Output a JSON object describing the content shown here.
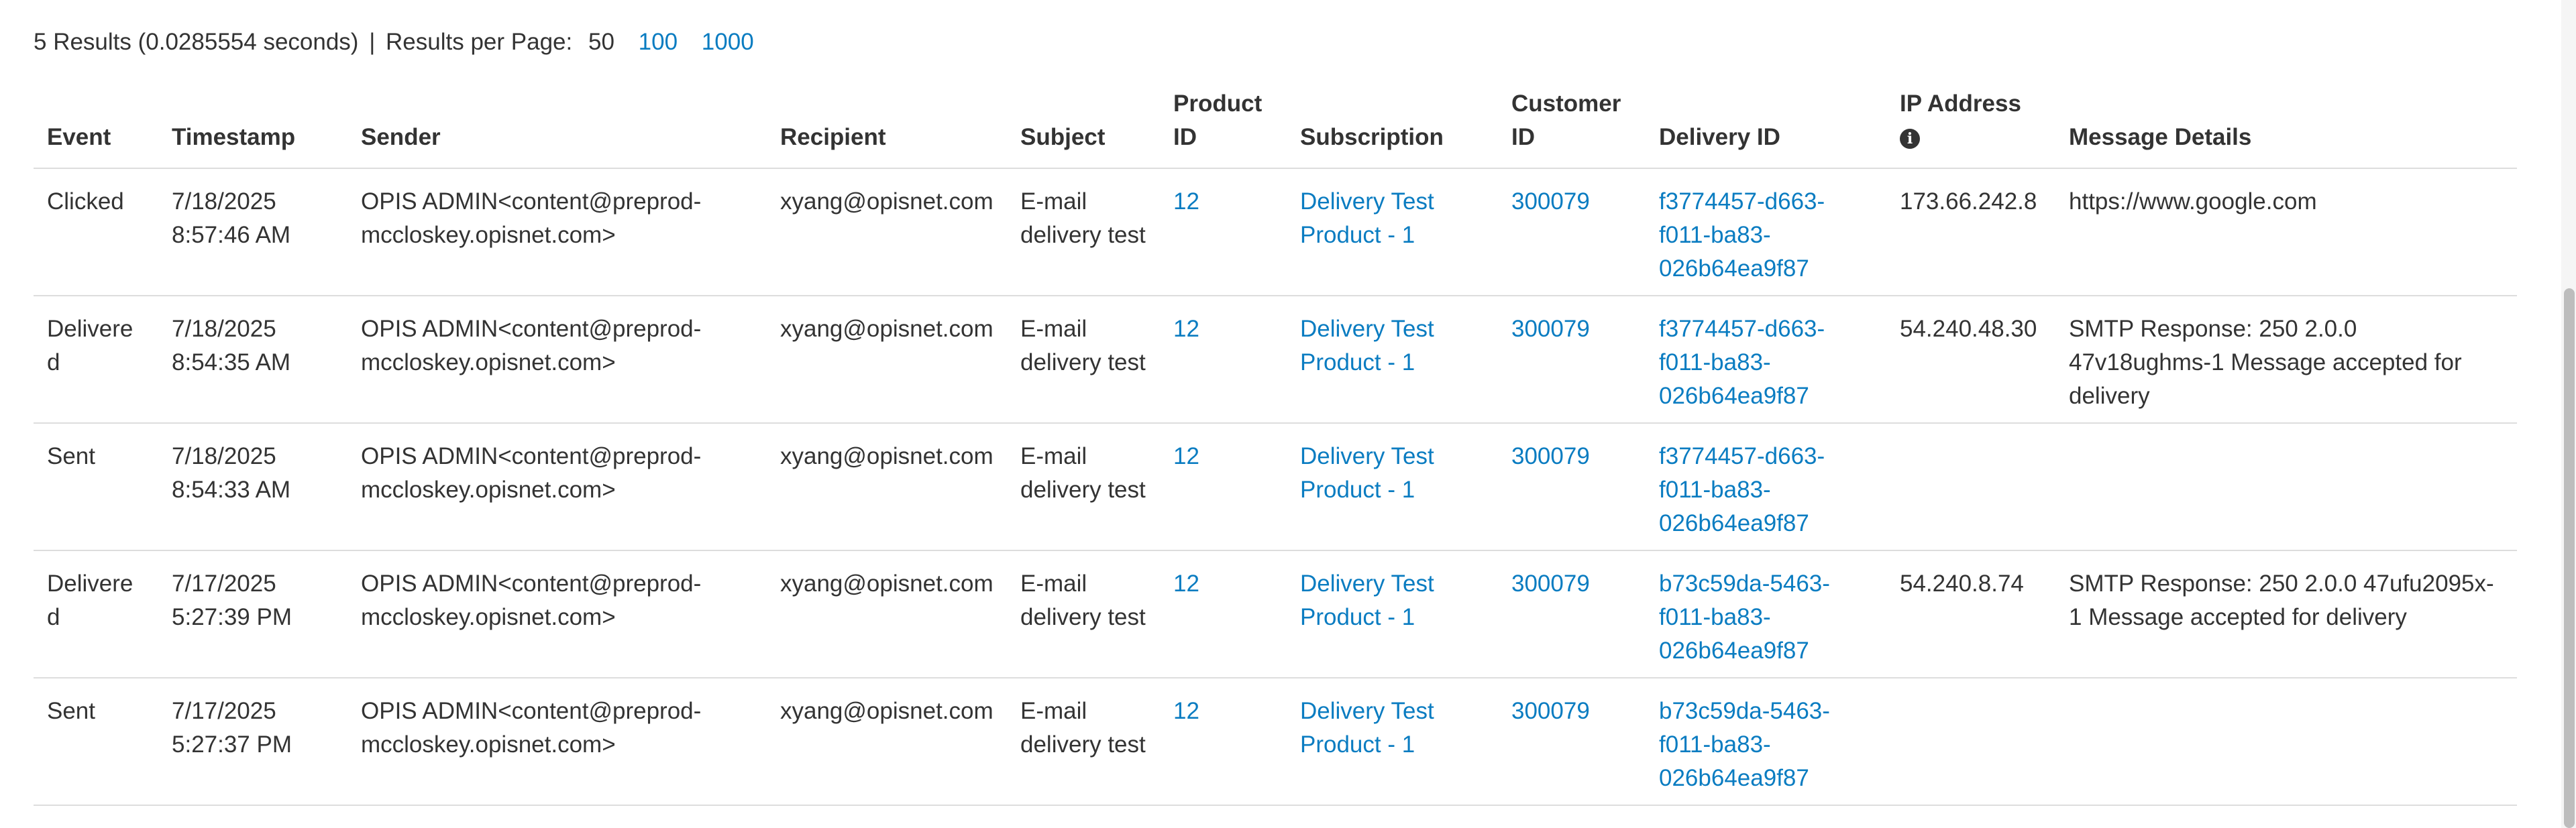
{
  "summary": {
    "results_text": "5 Results (0.0285554 seconds)",
    "separator": "|",
    "per_page_label": "Results per Page:",
    "per_page_current": "50",
    "per_page_options": [
      "100",
      "1000"
    ]
  },
  "table": {
    "headers": {
      "event": "Event",
      "timestamp": "Timestamp",
      "sender": "Sender",
      "recipient": "Recipient",
      "subject": "Subject",
      "product_id": "Product ID",
      "subscription": "Subscription",
      "customer_id": "Customer ID",
      "delivery_id": "Delivery ID",
      "ip_address": "IP Address",
      "message_details": "Message Details"
    },
    "ip_info_icon": "info-icon",
    "rows": [
      {
        "event": "Clicked",
        "timestamp": "7/18/2025 8:57:46 AM",
        "sender": "OPIS ADMIN<content@preprod-mccloskey.opisnet.com>",
        "recipient": "xyang@opisnet.com",
        "subject": "E-mail delivery test",
        "product_id": "12",
        "subscription": "Delivery Test Product - 1",
        "customer_id": "300079",
        "delivery_id": "f3774457-d663-f011-ba83-026b64ea9f87",
        "ip_address": "173.66.242.8",
        "message_details": "https://www.google.com"
      },
      {
        "event": "Delivered",
        "timestamp": "7/18/2025 8:54:35 AM",
        "sender": "OPIS ADMIN<content@preprod-mccloskey.opisnet.com>",
        "recipient": "xyang@opisnet.com",
        "subject": "E-mail delivery test",
        "product_id": "12",
        "subscription": "Delivery Test Product - 1",
        "customer_id": "300079",
        "delivery_id": "f3774457-d663-f011-ba83-026b64ea9f87",
        "ip_address": "54.240.48.30",
        "message_details": "SMTP Response: 250 2.0.0 47v18ughms-1 Message accepted for delivery"
      },
      {
        "event": "Sent",
        "timestamp": "7/18/2025 8:54:33 AM",
        "sender": "OPIS ADMIN<content@preprod-mccloskey.opisnet.com>",
        "recipient": "xyang@opisnet.com",
        "subject": "E-mail delivery test",
        "product_id": "12",
        "subscription": "Delivery Test Product - 1",
        "customer_id": "300079",
        "delivery_id": "f3774457-d663-f011-ba83-026b64ea9f87",
        "ip_address": "",
        "message_details": ""
      },
      {
        "event": "Delivered",
        "timestamp": "7/17/2025 5:27:39 PM",
        "sender": "OPIS ADMIN<content@preprod-mccloskey.opisnet.com>",
        "recipient": "xyang@opisnet.com",
        "subject": "E-mail delivery test",
        "product_id": "12",
        "subscription": "Delivery Test Product - 1",
        "customer_id": "300079",
        "delivery_id": "b73c59da-5463-f011-ba83-026b64ea9f87",
        "ip_address": "54.240.8.74",
        "message_details": "SMTP Response: 250 2.0.0 47ufu2095x-1 Message accepted for delivery"
      },
      {
        "event": "Sent",
        "timestamp": "7/17/2025 5:27:37 PM",
        "sender": "OPIS ADMIN<content@preprod-mccloskey.opisnet.com>",
        "recipient": "xyang@opisnet.com",
        "subject": "E-mail delivery test",
        "product_id": "12",
        "subscription": "Delivery Test Product - 1",
        "customer_id": "300079",
        "delivery_id": "b73c59da-5463-f011-ba83-026b64ea9f87",
        "ip_address": "",
        "message_details": ""
      }
    ]
  }
}
